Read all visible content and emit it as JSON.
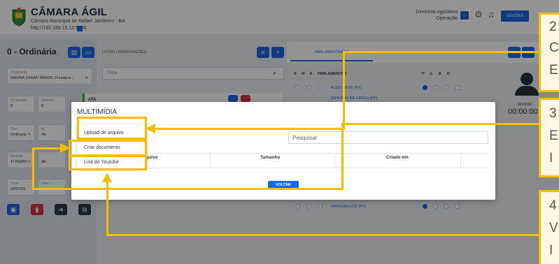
{
  "header": {
    "title": "CÂMARA ÁGIL",
    "subtitle": "Câmara Municipal de Rafael Jambeiro - BA",
    "url": "http://192.168.15.12:5000",
    "user_role_line1": "DiretoriaLegislativa",
    "user_role_line2": "Operação",
    "session_button": "SESSÕES"
  },
  "left": {
    "session_title": "0 - Ordinária",
    "presidente_label": "Presidente",
    "presidente_value": "MAGNA (UNIÃO BRASIL President...",
    "sessao_label": "Nº Sessão",
    "sessao_value": "0",
    "quorum_label": "Quórum",
    "quorum_value": "6",
    "tipo_label": "Tipo",
    "tipo_value": "Ordinaria",
    "m_label": "M",
    "m_value": "Ab",
    "periodo_label": "Período",
    "periodo_value": "1º PERÍO",
    "periodo2_value": "Ab",
    "data_label": "Data",
    "data_value": "30/07/20",
    "hora_label": "Hora"
  },
  "middle": {
    "breadcrumb": "LOTES \\ PROPOSIÇÕES",
    "filter_placeholder": "Filtrar",
    "item_prefix": "ATA"
  },
  "right": {
    "tab_parlamentares": "PARLAMENTARES",
    "col_s": "S",
    "col_n": "N",
    "col_a": "A",
    "col_parlamentar": "PARLAMENTAR",
    "col_p": "P",
    "col_l": "L",
    "col_a2": "A",
    "col_d": "D",
    "parl_1": "ALDO LEITE (PT)",
    "parl_2": "ANTONIO DE CIRILO (PT)",
    "parl_last": "VANGERLUCE (PT)",
    "timer_small": "00:00:00",
    "timer_big": "00:00:00"
  },
  "modal": {
    "title": "MULTIMÍDIA",
    "search_placeholder": "Pesquisar",
    "col_arquivo": "Arquivo",
    "col_tamanho": "Tamanho",
    "col_criado": "Criado em",
    "back_button": "VOLTAR",
    "menu_upload": "Upload de arquivo",
    "menu_criar": "Criar documento",
    "menu_youtube": "Link do Youtube"
  },
  "callouts": {
    "c2_line1": "2",
    "c2_line2": "C",
    "c2_line3": "E",
    "c3_line1": "3",
    "c3_line2": "E",
    "c3_line3": "I",
    "c4_line1": "4",
    "c4_line2": "V",
    "c4_line3": "I"
  },
  "colors": {
    "accent": "#1e66e0",
    "danger": "#d9334b",
    "annotation": "#f6be00"
  }
}
